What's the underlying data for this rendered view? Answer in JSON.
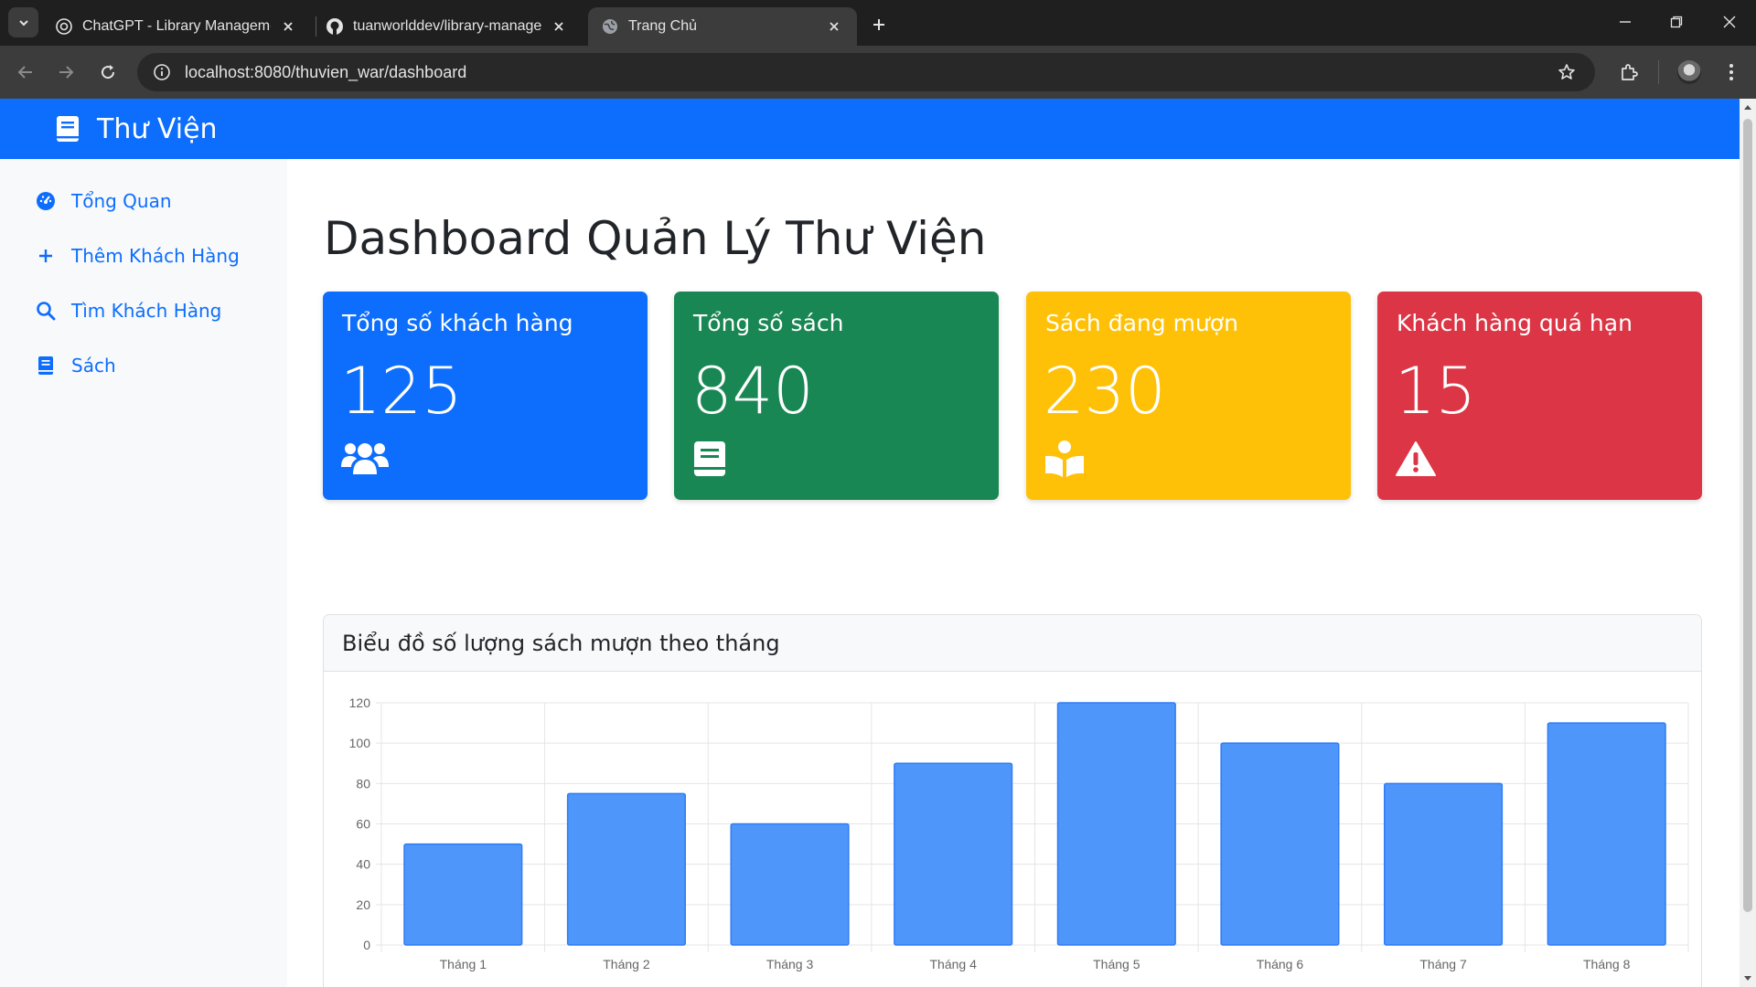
{
  "browser": {
    "tabs": [
      {
        "title": "ChatGPT - Library Management",
        "active": false,
        "favicon": "chatgpt-icon"
      },
      {
        "title": "tuanworlddev/library-managem",
        "active": false,
        "favicon": "github-icon"
      },
      {
        "title": "Trang Chủ",
        "active": true,
        "favicon": "globe-icon"
      }
    ],
    "url": "localhost:8080/thuvien_war/dashboard"
  },
  "navbar": {
    "brand": "Thư Viện",
    "color": "#0d6efd"
  },
  "sidebar": {
    "items": [
      {
        "label": "Tổng Quan",
        "icon": "dashboard-icon"
      },
      {
        "label": "Thêm Khách Hàng",
        "icon": "plus-icon"
      },
      {
        "label": "Tìm Khách Hàng",
        "icon": "search-icon"
      },
      {
        "label": "Sách",
        "icon": "book-icon"
      }
    ]
  },
  "main": {
    "title": "Dashboard Quản Lý Thư Viện",
    "cards": [
      {
        "title": "Tổng số khách hàng",
        "value": "125",
        "color": "#0d6efd",
        "icon": "users-icon"
      },
      {
        "title": "Tổng số sách",
        "value": "840",
        "color": "#198754",
        "icon": "book-icon"
      },
      {
        "title": "Sách đang mượn",
        "value": "230",
        "color": "#ffc107",
        "icon": "reading-icon"
      },
      {
        "title": "Khách hàng quá hạn",
        "value": "15",
        "color": "#dc3545",
        "icon": "warning-icon"
      }
    ],
    "chart_title": "Biểu đồ số lượng sách mượn theo tháng"
  },
  "chart_data": {
    "type": "bar",
    "categories": [
      "Tháng 1",
      "Tháng 2",
      "Tháng 3",
      "Tháng 4",
      "Tháng 5",
      "Tháng 6",
      "Tháng 7",
      "Tháng 8"
    ],
    "values": [
      50,
      75,
      60,
      90,
      120,
      100,
      80,
      110
    ],
    "title": "Biểu đồ số lượng sách mượn theo tháng",
    "xlabel": "",
    "ylabel": "",
    "ylim": [
      0,
      120
    ],
    "yticks": [
      0,
      20,
      40,
      60,
      80,
      100,
      120
    ],
    "grid": true,
    "bar_color": "#4f96fb",
    "bar_border_color": "#2e7cf6"
  }
}
